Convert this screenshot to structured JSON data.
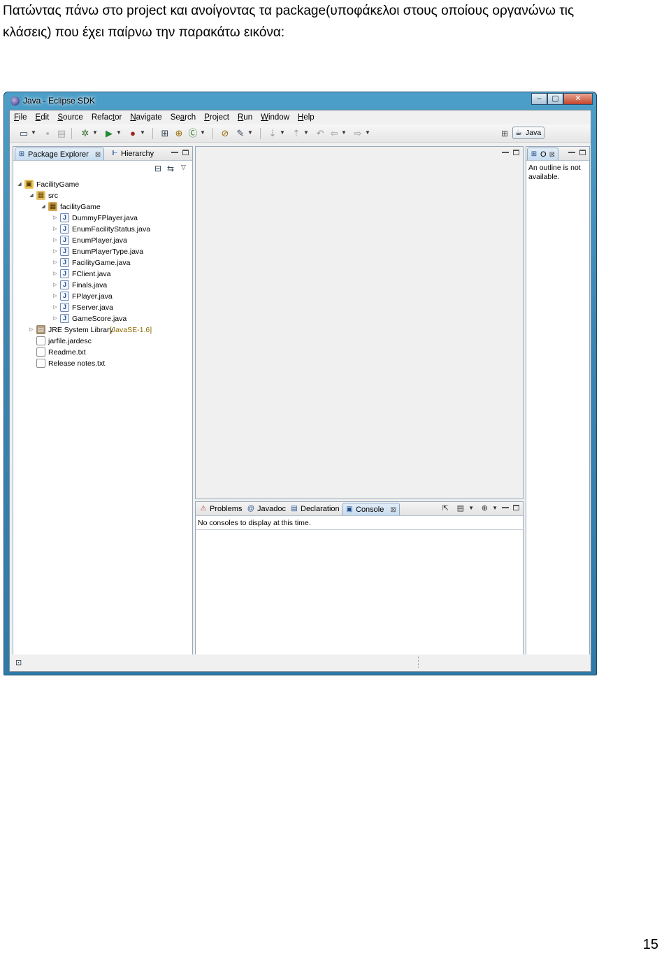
{
  "document": {
    "line1": "Πατώντας πάνω στο project και ανοίγοντας τα package(υποφάκελοι στους οποίους οργανώνω τις",
    "line2": "κλάσεις)  που έχει παίρνω την παρακάτω εικόνα:",
    "page_number": "15"
  },
  "window": {
    "title": "Java - Eclipse SDK",
    "controls": {
      "minimize": "–",
      "maximize": "▢",
      "close": "✕"
    }
  },
  "menu": [
    {
      "pre": "",
      "acc": "F",
      "post": "ile"
    },
    {
      "pre": "",
      "acc": "E",
      "post": "dit"
    },
    {
      "pre": "",
      "acc": "S",
      "post": "ource"
    },
    {
      "pre": "Refac",
      "acc": "t",
      "post": "or"
    },
    {
      "pre": "",
      "acc": "N",
      "post": "avigate"
    },
    {
      "pre": "Se",
      "acc": "a",
      "post": "rch"
    },
    {
      "pre": "",
      "acc": "P",
      "post": "roject"
    },
    {
      "pre": "",
      "acc": "R",
      "post": "un"
    },
    {
      "pre": "",
      "acc": "W",
      "post": "indow"
    },
    {
      "pre": "",
      "acc": "H",
      "post": "elp"
    }
  ],
  "toolbar": {
    "perspective_label": "Java",
    "icons": [
      "new-icon",
      "save-icon",
      "print-icon",
      "debug-icon",
      "run-icon",
      "external-tools-icon",
      "new-java-project-icon",
      "new-package-icon",
      "new-class-icon",
      "open-type-icon",
      "search-icon",
      "next-annotation-icon",
      "previous-annotation-icon",
      "last-edit-icon",
      "back-icon",
      "forward-icon",
      "open-perspective-icon"
    ]
  },
  "left_pane": {
    "tabs": [
      {
        "label": "Package Explorer",
        "close": "⊠"
      },
      {
        "label": "Hierarchy"
      }
    ],
    "tree": [
      {
        "label": "FacilityGame",
        "depth": 0,
        "expanded": true,
        "type": "project"
      },
      {
        "label": "src",
        "depth": 1,
        "expanded": true,
        "type": "src"
      },
      {
        "label": "facilityGame",
        "depth": 2,
        "expanded": true,
        "type": "package"
      },
      {
        "label": "DummyFPlayer.java",
        "depth": 3,
        "expanded": false,
        "type": "java"
      },
      {
        "label": "EnumFacilityStatus.java",
        "depth": 3,
        "expanded": false,
        "type": "java"
      },
      {
        "label": "EnumPlayer.java",
        "depth": 3,
        "expanded": false,
        "type": "java"
      },
      {
        "label": "EnumPlayerType.java",
        "depth": 3,
        "expanded": false,
        "type": "java"
      },
      {
        "label": "FacilityGame.java",
        "depth": 3,
        "expanded": false,
        "type": "java"
      },
      {
        "label": "FClient.java",
        "depth": 3,
        "expanded": false,
        "type": "java"
      },
      {
        "label": "Finals.java",
        "depth": 3,
        "expanded": false,
        "type": "java"
      },
      {
        "label": "FPlayer.java",
        "depth": 3,
        "expanded": false,
        "type": "java"
      },
      {
        "label": "FServer.java",
        "depth": 3,
        "expanded": false,
        "type": "java"
      },
      {
        "label": "GameScore.java",
        "depth": 3,
        "expanded": false,
        "type": "java"
      },
      {
        "label": "JRE System Library",
        "suffix": " [JavaSE-1.6]",
        "depth": 1,
        "expanded": false,
        "type": "library"
      },
      {
        "label": "jarfile.jardesc",
        "depth": 1,
        "expanded": null,
        "type": "file"
      },
      {
        "label": "Readme.txt",
        "depth": 1,
        "expanded": null,
        "type": "file"
      },
      {
        "label": "Release notes.txt",
        "depth": 1,
        "expanded": null,
        "type": "file"
      }
    ]
  },
  "outline_pane": {
    "tab_label": "O",
    "tab_close": "⊠",
    "message_line1": "An outline is not",
    "message_line2": "available."
  },
  "bottom_pane": {
    "tabs": [
      {
        "label": "Problems"
      },
      {
        "label": "Javadoc"
      },
      {
        "label": "Declaration"
      },
      {
        "label": "Console",
        "close": "⊠"
      }
    ],
    "message": "No consoles to display at this time."
  },
  "colors": {
    "window_frame": "#3a86b3",
    "active_tab": "#c7dcef",
    "pane_border": "#99a8b8"
  }
}
